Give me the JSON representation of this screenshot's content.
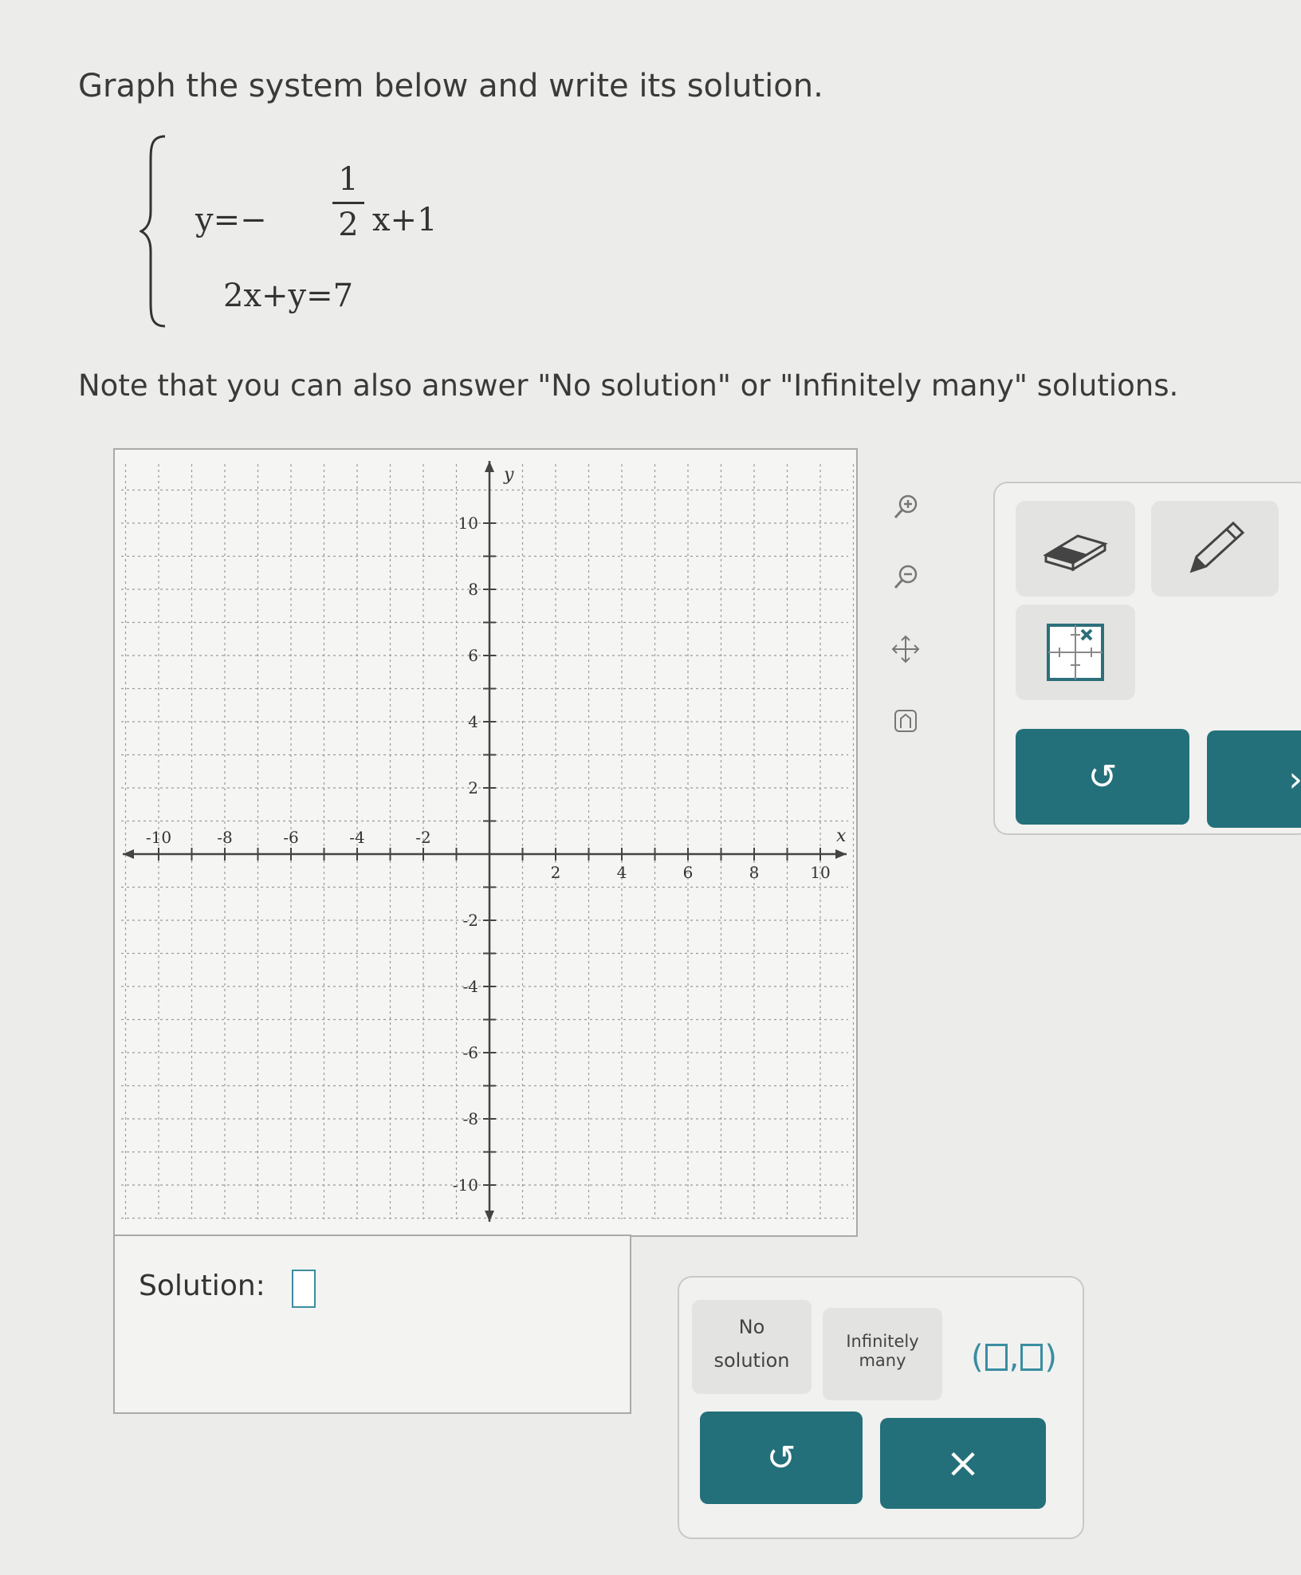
{
  "instruction": "Graph the system below and write its solution.",
  "system": {
    "eq1_lhs": "y=−",
    "eq1_num": "1",
    "eq1_den": "2",
    "eq1_rhs": "x+1",
    "eq2": "2x+y=7"
  },
  "note": "Note that you can also answer \"No solution\" or \"Infinitely many\" solutions.",
  "graph": {
    "x_axis_label": "x",
    "y_axis_label": "y",
    "xlim": [
      -10,
      10
    ],
    "ylim": [
      -10,
      10
    ],
    "x_ticks": [
      "-10",
      "-8",
      "-6",
      "-4",
      "-2",
      "2",
      "4",
      "6",
      "8",
      "10"
    ],
    "y_ticks": [
      "10",
      "8",
      "6",
      "4",
      "2",
      "-2",
      "-4",
      "-6",
      "-8",
      "-10"
    ]
  },
  "side_tools": [
    "zoom-in-icon",
    "zoom-out-icon",
    "pan-icon",
    "home-icon"
  ],
  "tool_panel": {
    "tools": [
      "eraser-icon",
      "pencil-icon",
      "line-tool-icon"
    ],
    "undo_icon": "↺",
    "clear_icon": "›"
  },
  "solution": {
    "label": "Solution:"
  },
  "answer_panel": {
    "no_solution_line1": "No",
    "no_solution_line2": "solution",
    "infinitely_line1": "Infinitely",
    "infinitely_line2": "many",
    "pair_open": "(",
    "pair_comma": ",",
    "pair_close": ")",
    "undo_icon": "↺",
    "clear_icon": "×"
  },
  "colors": {
    "teal": "#23707a",
    "slot_blue": "#3a8da0"
  }
}
